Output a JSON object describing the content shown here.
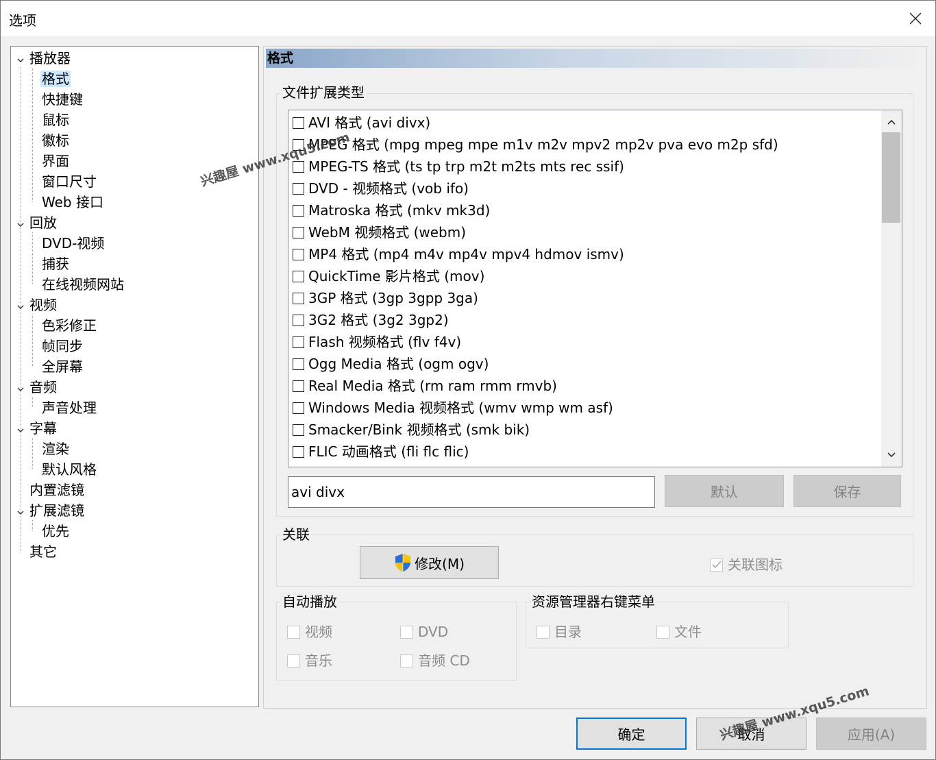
{
  "window": {
    "title": "选项"
  },
  "tree": {
    "items": [
      {
        "label": "播放器",
        "level": 0,
        "expanded": true
      },
      {
        "label": "格式",
        "level": 1,
        "selected": true
      },
      {
        "label": "快捷键",
        "level": 1
      },
      {
        "label": "鼠标",
        "level": 1
      },
      {
        "label": "徽标",
        "level": 1
      },
      {
        "label": "界面",
        "level": 1
      },
      {
        "label": "窗口尺寸",
        "level": 1
      },
      {
        "label": "Web 接口",
        "level": 1
      },
      {
        "label": "回放",
        "level": 0,
        "expanded": true
      },
      {
        "label": "DVD-视频",
        "level": 1
      },
      {
        "label": "捕获",
        "level": 1
      },
      {
        "label": "在线视频网站",
        "level": 1
      },
      {
        "label": "视频",
        "level": 0,
        "expanded": true
      },
      {
        "label": "色彩修正",
        "level": 1
      },
      {
        "label": "帧同步",
        "level": 1
      },
      {
        "label": "全屏幕",
        "level": 1
      },
      {
        "label": "音频",
        "level": 0,
        "expanded": true
      },
      {
        "label": "声音处理",
        "level": 1
      },
      {
        "label": "字幕",
        "level": 0,
        "expanded": true
      },
      {
        "label": "渲染",
        "level": 1
      },
      {
        "label": "默认风格",
        "level": 1
      },
      {
        "label": "内置滤镜",
        "level": 0
      },
      {
        "label": "扩展滤镜",
        "level": 0,
        "expanded": true
      },
      {
        "label": "优先",
        "level": 1
      },
      {
        "label": "其它",
        "level": 0
      }
    ]
  },
  "panel": {
    "header": "格式",
    "file_ext_group": "文件扩展类型",
    "formats": [
      "AVI 格式 (avi divx)",
      "MPEG 格式 (mpg mpeg mpe m1v m2v mpv2 mp2v pva evo m2p sfd)",
      "MPEG-TS 格式 (ts tp trp m2t m2ts mts rec ssif)",
      "DVD - 视频格式 (vob ifo)",
      "Matroska 格式 (mkv mk3d)",
      "WebM 视频格式 (webm)",
      "MP4 格式 (mp4 m4v mp4v mpv4 hdmov ismv)",
      "QuickTime 影片格式 (mov)",
      "3GP 格式 (3gp 3gpp 3ga)",
      "3G2 格式 (3g2 3gp2)",
      "Flash 视频格式 (flv f4v)",
      "Ogg Media 格式 (ogm ogv)",
      "Real Media 格式 (rm ram rmm rmvb)",
      "Windows Media 视频格式 (wmv wmp wm asf)",
      "Smacker/Bink 视频格式 (smk bik)",
      "FLIC 动画格式 (fli flc flic)"
    ],
    "ext_input_value": "avi divx",
    "default_button": "默认",
    "save_button": "保存",
    "assoc_group": "关联",
    "modify_button": "修改(M)",
    "assoc_icon_label": "关联图标",
    "autoplay_group": "自动播放",
    "autoplay": {
      "video": "视频",
      "dvd": "DVD",
      "music": "音乐",
      "audio_cd": "音频 CD"
    },
    "explorer_group": "资源管理器右键菜单",
    "explorer": {
      "dir": "目录",
      "file": "文件"
    }
  },
  "footer": {
    "ok": "确定",
    "cancel": "取消",
    "apply": "应用(A)"
  },
  "watermarks": [
    "兴趣屋 www.xqu5.com",
    "兴趣屋 www.xqu5.com"
  ],
  "colors": {
    "selection": "#cce8ff",
    "header_gradient": "#8aa6c9",
    "focus_border": "#0078d7"
  }
}
